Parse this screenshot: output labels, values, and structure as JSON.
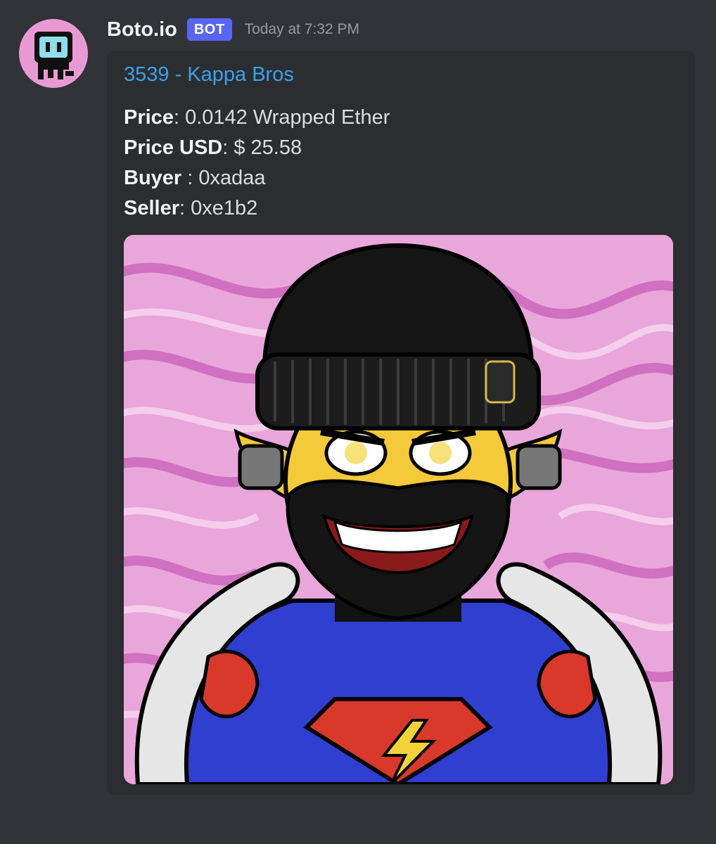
{
  "message": {
    "author": "Boto.io",
    "bot_tag": "BOT",
    "timestamp": "Today at 7:32 PM"
  },
  "embed": {
    "title": "3539 - Kappa Bros",
    "fields": [
      {
        "label": "Price",
        "separator": ": ",
        "value": "0.0142 Wrapped Ether"
      },
      {
        "label": "Price USD",
        "separator": ": ",
        "value": "$ 25.58"
      },
      {
        "label": "Buyer",
        "separator": " : ",
        "value": "0xadaa"
      },
      {
        "label": "Seller",
        "separator": ": ",
        "value": "0xe1b2"
      }
    ],
    "image": {
      "subject": "nft-artwork",
      "background_color": "#e9a6db"
    }
  },
  "colors": {
    "app_background": "#313338",
    "embed_background": "#2b2d31",
    "link": "#3aa1e8",
    "bot_tag": "#5865f2",
    "avatar_background": "#ea9ad2"
  },
  "icons": {
    "avatar": "robot-avatar-icon"
  }
}
